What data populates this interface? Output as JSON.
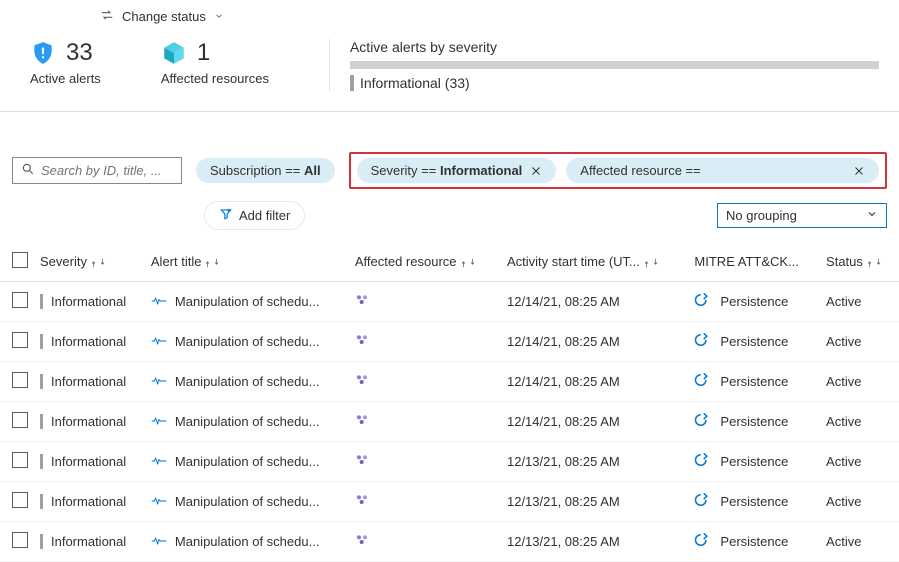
{
  "topbar": {
    "change_status": "Change status"
  },
  "summary": {
    "active_alerts_count": "33",
    "active_alerts_label": "Active alerts",
    "affected_count": "1",
    "affected_label": "Affected resources",
    "severity_title": "Active alerts by severity",
    "severity_breakdown": "Informational (33)"
  },
  "filters": {
    "search_placeholder": "Search by ID, title, ...",
    "subscription_prefix": "Subscription == ",
    "subscription_value": "All",
    "severity_prefix": "Severity == ",
    "severity_value": "Informational",
    "affected_prefix": "Affected resource ==",
    "add_filter": "Add filter",
    "grouping": "No grouping"
  },
  "columns": {
    "severity": "Severity",
    "alert_title": "Alert title",
    "affected_resource": "Affected resource",
    "activity_start": "Activity start time (UT...",
    "mitre": "MITRE ATT&CK...",
    "status": "Status"
  },
  "rows": [
    {
      "severity": "Informational",
      "title": "Manipulation of schedu...",
      "time": "12/14/21, 08:25 AM",
      "mitre": "Persistence",
      "status": "Active"
    },
    {
      "severity": "Informational",
      "title": "Manipulation of schedu...",
      "time": "12/14/21, 08:25 AM",
      "mitre": "Persistence",
      "status": "Active"
    },
    {
      "severity": "Informational",
      "title": "Manipulation of schedu...",
      "time": "12/14/21, 08:25 AM",
      "mitre": "Persistence",
      "status": "Active"
    },
    {
      "severity": "Informational",
      "title": "Manipulation of schedu...",
      "time": "12/14/21, 08:25 AM",
      "mitre": "Persistence",
      "status": "Active"
    },
    {
      "severity": "Informational",
      "title": "Manipulation of schedu...",
      "time": "12/13/21, 08:25 AM",
      "mitre": "Persistence",
      "status": "Active"
    },
    {
      "severity": "Informational",
      "title": "Manipulation of schedu...",
      "time": "12/13/21, 08:25 AM",
      "mitre": "Persistence",
      "status": "Active"
    },
    {
      "severity": "Informational",
      "title": "Manipulation of schedu...",
      "time": "12/13/21, 08:25 AM",
      "mitre": "Persistence",
      "status": "Active"
    }
  ]
}
